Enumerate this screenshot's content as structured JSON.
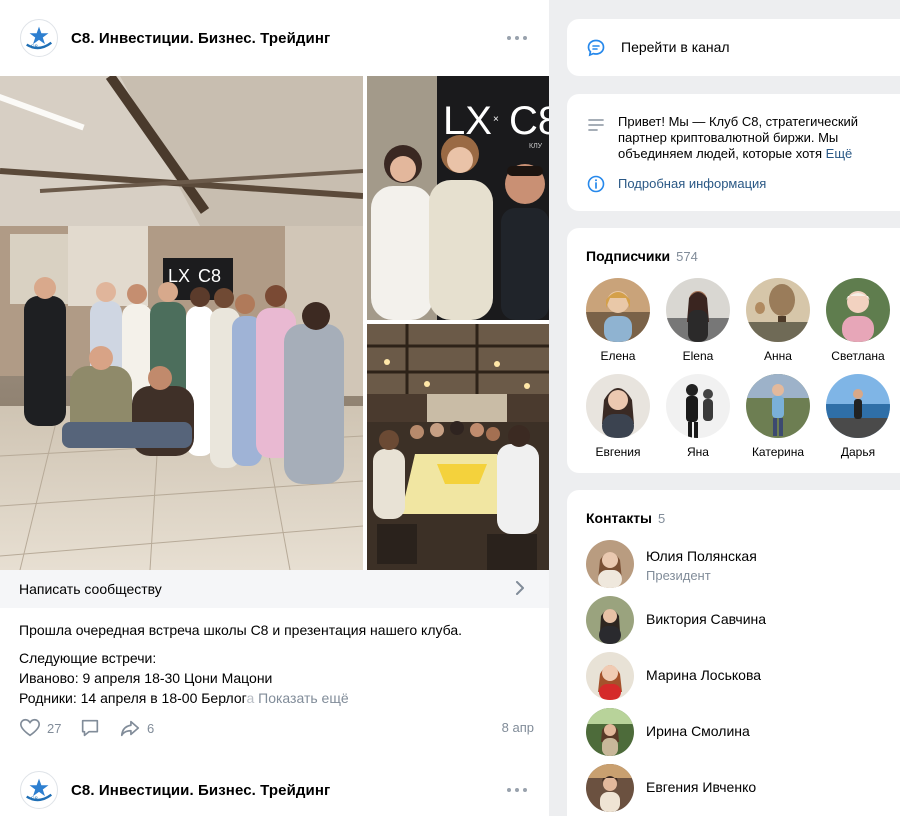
{
  "posts": [
    {
      "author": "С8. Инвестиции. Бизнес. Трейдинг",
      "write_label": "Написать сообществу",
      "text_line1": "Прошла очередная встреча школы С8 и презентация нашего клуба.",
      "text_line2": "Следующие встречи:",
      "text_line3": "Иваново: 9 апреля 18-30 Цони Мацони",
      "text_line4_visible": "Родники: 14 апреля в 18-00 Берлог",
      "text_line4_faded": "а",
      "show_more": "Показать ещё",
      "likes": "27",
      "shares": "6",
      "date": "8 апр",
      "photo_banner_text": "LX × C8",
      "photo_banner_sub": "клуб"
    },
    {
      "author": "С8. Инвестиции. Бизнес. Трейдинг"
    }
  ],
  "sidebar": {
    "channel_label": "Перейти в канал",
    "description": "Привет! Мы — Клуб С8, стратегический партнер криптовалютной биржи. Мы объединяем людей, которые хотя",
    "description_more": "Ещё",
    "info_link": "Подробная информация",
    "subscribers_title": "Подписчики",
    "subscribers_count": "574",
    "subscribers": [
      {
        "name": "Елена"
      },
      {
        "name": "Elena"
      },
      {
        "name": "Анна"
      },
      {
        "name": "Светлана"
      },
      {
        "name": "Евгения"
      },
      {
        "name": "Яна"
      },
      {
        "name": "Катерина"
      },
      {
        "name": "Дарья"
      }
    ],
    "contacts_title": "Контакты",
    "contacts_count": "5",
    "contacts": [
      {
        "name": "Юлия Полянская",
        "role": "Президент"
      },
      {
        "name": "Виктория Савчина",
        "role": ""
      },
      {
        "name": "Марина Лоськова",
        "role": ""
      },
      {
        "name": "Ирина Смолина",
        "role": ""
      },
      {
        "name": "Евгения Ивченко",
        "role": ""
      }
    ]
  },
  "colors": {
    "link": "#2a5885",
    "muted": "#818c99",
    "page_bg": "#edeef0",
    "accent_icon": "#2688eb"
  }
}
